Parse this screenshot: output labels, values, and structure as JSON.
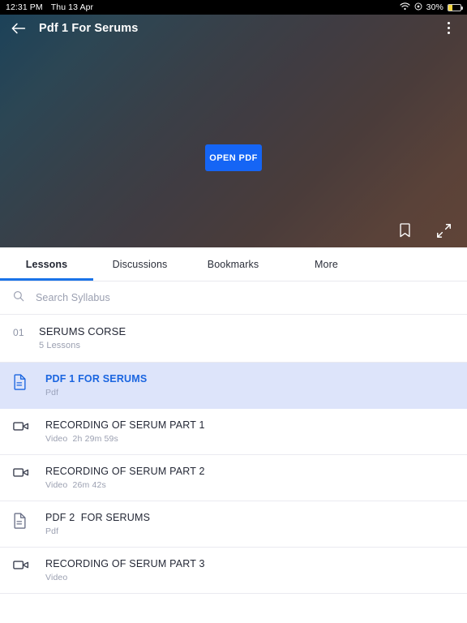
{
  "status_bar": {
    "time": "12:31 PM",
    "date": "Thu 13 Apr",
    "wifi_icon": "wifi-icon",
    "location_icon": "location-icon",
    "battery_percent": "30%",
    "battery_icon": "battery-icon",
    "battery_level": 30
  },
  "app_bar": {
    "back_icon": "back-arrow-icon",
    "title": "Pdf 1 For Serums",
    "menu_icon": "kebab-menu-icon"
  },
  "hero": {
    "open_button_label": "OPEN PDF",
    "bookmark_icon": "bookmark-icon",
    "fullscreen_icon": "fullscreen-expand-icon",
    "gradient_start": "#1c4259",
    "gradient_end": "#604437"
  },
  "tabs": {
    "active_index": 0,
    "accent_color": "#1a73e8",
    "items": [
      {
        "label": "Lessons"
      },
      {
        "label": "Discussions"
      },
      {
        "label": "Bookmarks"
      },
      {
        "label": "More"
      }
    ]
  },
  "search": {
    "icon": "search-icon",
    "placeholder": "Search Syllabus",
    "value": ""
  },
  "syllabus": {
    "section": {
      "number": "01",
      "title": "SERUMS CORSE",
      "subtitle": "5 Lessons"
    },
    "items": [
      {
        "icon": "pdf-document-icon",
        "title": "PDF 1 FOR SERUMS",
        "meta": "Pdf",
        "selected": true
      },
      {
        "icon": "video-camera-icon",
        "title": "RECORDING OF SERUM PART 1",
        "meta": "Video  2h 29m 59s",
        "selected": false
      },
      {
        "icon": "video-camera-icon",
        "title": "RECORDING OF SERUM PART 2",
        "meta": "Video  26m 42s",
        "selected": false
      },
      {
        "icon": "pdf-document-icon",
        "title": "PDF 2  FOR SERUMS",
        "meta": "Pdf",
        "selected": false
      },
      {
        "icon": "video-camera-icon",
        "title": "RECORDING OF SERUM PART 3",
        "meta": "Video",
        "selected": false
      }
    ]
  }
}
